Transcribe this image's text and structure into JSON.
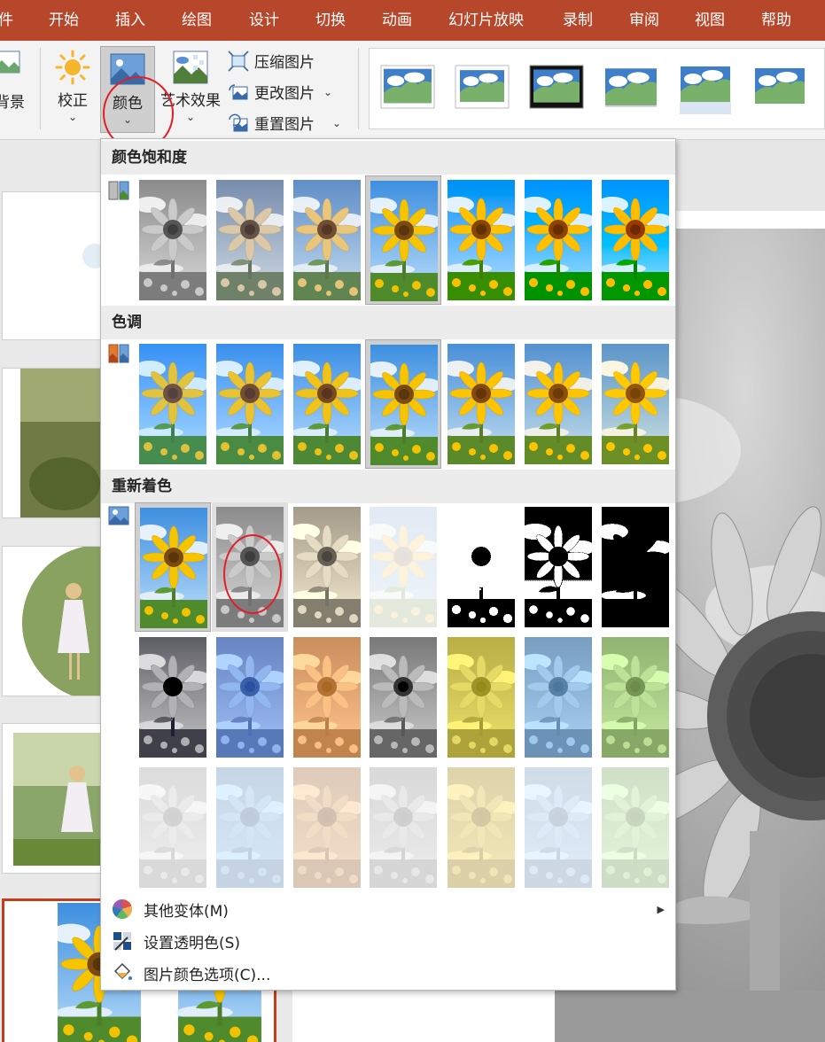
{
  "tabs": [
    "件",
    "开始",
    "插入",
    "绘图",
    "设计",
    "切换",
    "动画",
    "幻灯片放映",
    "录制",
    "审阅",
    "视图",
    "帮助"
  ],
  "ribbon": {
    "background_label": "背景",
    "correct_label": "校正",
    "color_label": "颜色",
    "artistic_label": "艺术效果",
    "compress_label": "压缩图片",
    "change_label": "更改图片",
    "reset_label": "重置图片"
  },
  "dropdown": {
    "saturation_title": "颜色饱和度",
    "tone_title": "色调",
    "recolor_title": "重新着色",
    "more_variants": "其他变体(M)",
    "set_transparent": "设置透明色(S)",
    "picture_color_options": "图片颜色选项(C)..."
  },
  "colors": {
    "accent": "#b7472a",
    "annotation": "#e21f26"
  }
}
